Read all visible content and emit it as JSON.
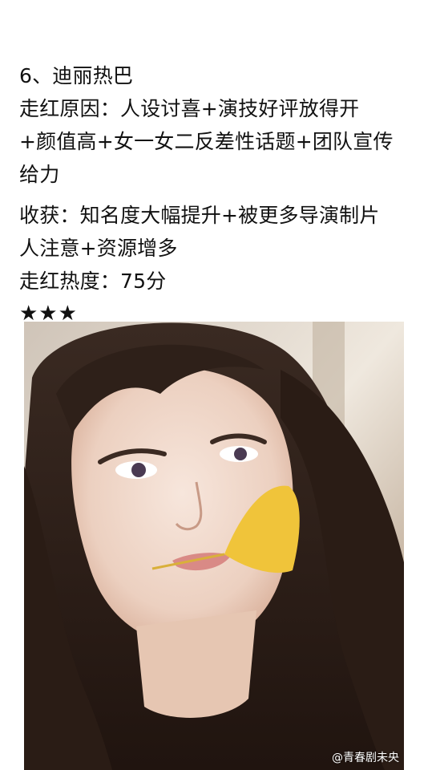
{
  "article": {
    "heading": "6、迪丽热巴",
    "reason_lines": [
      "走红原因：人设讨喜+演技好评放得开",
      "+颜值高+女一女二反差性话题+团队宣传",
      "给力"
    ],
    "gain_lines": [
      "收获：知名度大幅提升+被更多导演制片",
      "人注意+资源增多"
    ],
    "heat": "走红热度：75分",
    "stars": "★★★"
  },
  "photo": {
    "watermark": "@青春剧未央"
  }
}
